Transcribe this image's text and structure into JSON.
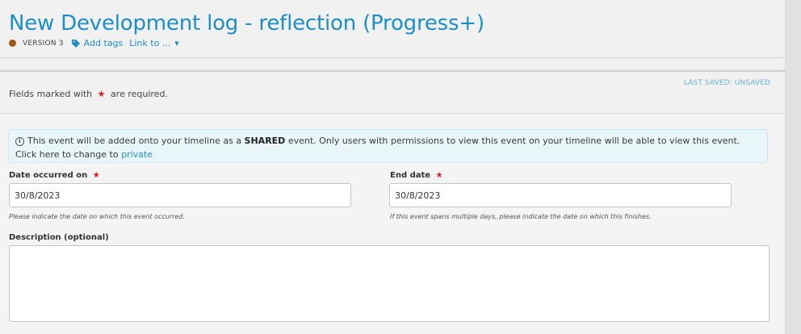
{
  "header": {
    "title": "New Development log - reflection (Progress+)",
    "version": "VERSION 3",
    "add_tags": "Add tags",
    "link_to": "Link to ...",
    "status_dot_color": "#a05a10"
  },
  "form": {
    "last_saved": "LAST SAVED: UNSAVED",
    "required_prefix": "Fields marked with",
    "required_suffix": "are required.",
    "required_star": "★",
    "info": {
      "text_before": "This event will be added onto your timeline as a",
      "shared": "SHARED",
      "text_after": "event. Only users with permissions to view this event on your timeline will be able to view this event. Click here to change to",
      "private_link": "private"
    },
    "date_occurred": {
      "label": "Date occurred on",
      "value": "30/8/2023",
      "help": "Please indicate the date on which this event occurred."
    },
    "end_date": {
      "label": "End date",
      "value": "30/8/2023",
      "help": "If this event spans multiple days, please indicate the date on which this finishes."
    },
    "description": {
      "label": "Description (optional)",
      "value": ""
    }
  },
  "colors": {
    "accent": "#1c8fc7",
    "required": "#e0191e",
    "info_bg": "#e8f5f9"
  }
}
